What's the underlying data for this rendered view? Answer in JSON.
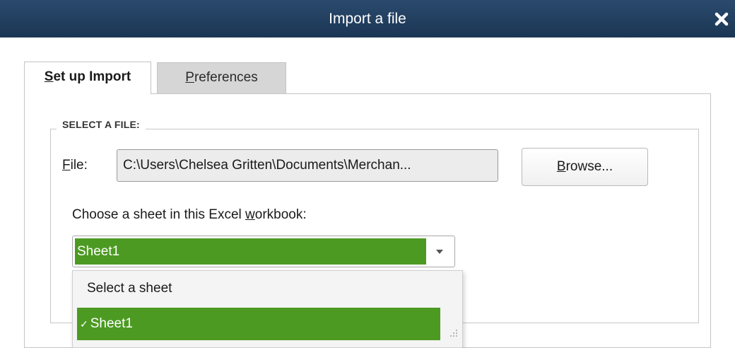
{
  "window": {
    "title": "Import a file",
    "close_icon": "close-icon"
  },
  "tabs": [
    {
      "label_mnemonic": "S",
      "label_rest": "et up Import",
      "active": true
    },
    {
      "label_mnemonic": "P",
      "label_rest": "references",
      "active": false
    }
  ],
  "select_file": {
    "legend": "SELECT A FILE:",
    "file_label_mnemonic": "F",
    "file_label_rest": "ile:",
    "file_value": "C:\\Users\\Chelsea Gritten\\Documents\\Merchan...",
    "browse_mnemonic": "B",
    "browse_rest": "rowse...",
    "sheet_label_before": "Choose a sheet in this Excel ",
    "sheet_label_mnemonic": "w",
    "sheet_label_after": "orkbook:",
    "sheet_selected": "Sheet1",
    "dropdown_arrow_icon": "chevron-down-icon"
  },
  "dropdown": {
    "options": [
      {
        "label": "Select a sheet",
        "selected": false
      },
      {
        "label": "Sheet1",
        "selected": true,
        "check": "✓"
      }
    ],
    "resize_icon": "resize-grip-icon"
  },
  "colors": {
    "titlebar": "#1f3a5a",
    "selection_green": "#4c9a22"
  }
}
